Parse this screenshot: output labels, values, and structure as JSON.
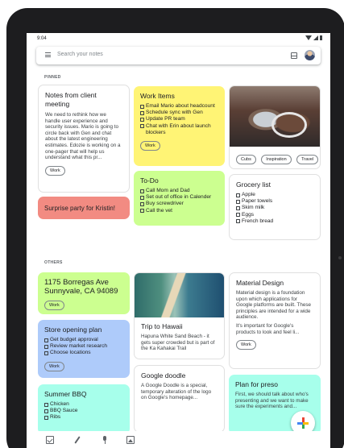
{
  "status_bar": {
    "time": "9:04"
  },
  "search": {
    "placeholder": "Search your notes"
  },
  "icons": {
    "menu": "menu-icon",
    "view_toggle": "grid-view-icon",
    "avatar": "avatar",
    "fab": "plus-icon",
    "bottom": [
      "checkbox-icon",
      "brush-icon",
      "mic-icon",
      "image-icon"
    ]
  },
  "sections": {
    "pinned": "PINNED",
    "others": "OTHERS"
  },
  "colors": {
    "yellow": "#fff475",
    "green": "#ccff90",
    "red": "#f28b82",
    "blue": "#aecbfa",
    "teal": "#a7ffeb",
    "white": "#ffffff"
  },
  "pinned": {
    "client_meeting": {
      "title": "Notes from client meeting",
      "body": "We need to rethink how we handle user experience and security issues. Mario is going to circle back with Gen and chat about the latest engineering estimates. Edozie is working on a one-pager that will help us understand what this pr...",
      "label": "Work"
    },
    "surprise_party": {
      "title": "Surprise party for Kristin!"
    },
    "work_items": {
      "title": "Work Items",
      "items": [
        "Email Mario about headcount",
        "Schedule sync with Gen",
        "Update PR team",
        "Chat with Erin about launch blockers"
      ],
      "label": "Work"
    },
    "todo": {
      "title": "To-Do",
      "items": [
        "Call Mom and Dad",
        "Set out of office in Calender",
        "Buy screwdriver",
        "Call the vet"
      ]
    },
    "car_photo": {
      "labels": [
        "Cubs",
        "Inspiration",
        "Travel"
      ]
    },
    "grocery": {
      "title": "Grocery list",
      "items": [
        "Apple",
        "Paper towels",
        "Skim milk",
        "Eggs",
        "French bread"
      ]
    }
  },
  "others": {
    "address": {
      "title": "1175 Borregas Ave Sunnyvale, CA 94089",
      "label": "Work"
    },
    "store_opening": {
      "title": "Store opening plan",
      "items": [
        "Get budget approval",
        "Review market research",
        "Choose locations"
      ],
      "label": "Work"
    },
    "summer_bbq": {
      "title": "Summer BBQ",
      "items": [
        "Chicken",
        "BBQ Sauce",
        "Ribs"
      ]
    },
    "hawaii": {
      "title": "Trip to Hawaii",
      "body": "Hapuna White Sand Beach - it gets super crowded but is part of the Ka Kahakai Trail"
    },
    "google_doodle": {
      "title": "Google doodle",
      "body": "A Google Doodle is a special, temporary alteration of the logo on Google's homepage..."
    },
    "material_design": {
      "title": "Material Design",
      "body1": "Material design is a foundation upon which applications for Google platforms are built. These principles are intended for a wide audience.",
      "body2": "It's important for Google's products to look and feel li...",
      "label": "Work"
    },
    "plan_for_preso": {
      "title": "Plan for preso",
      "body": "First, we should talk about who's presenting and we want to make sure the experiments and..."
    }
  }
}
